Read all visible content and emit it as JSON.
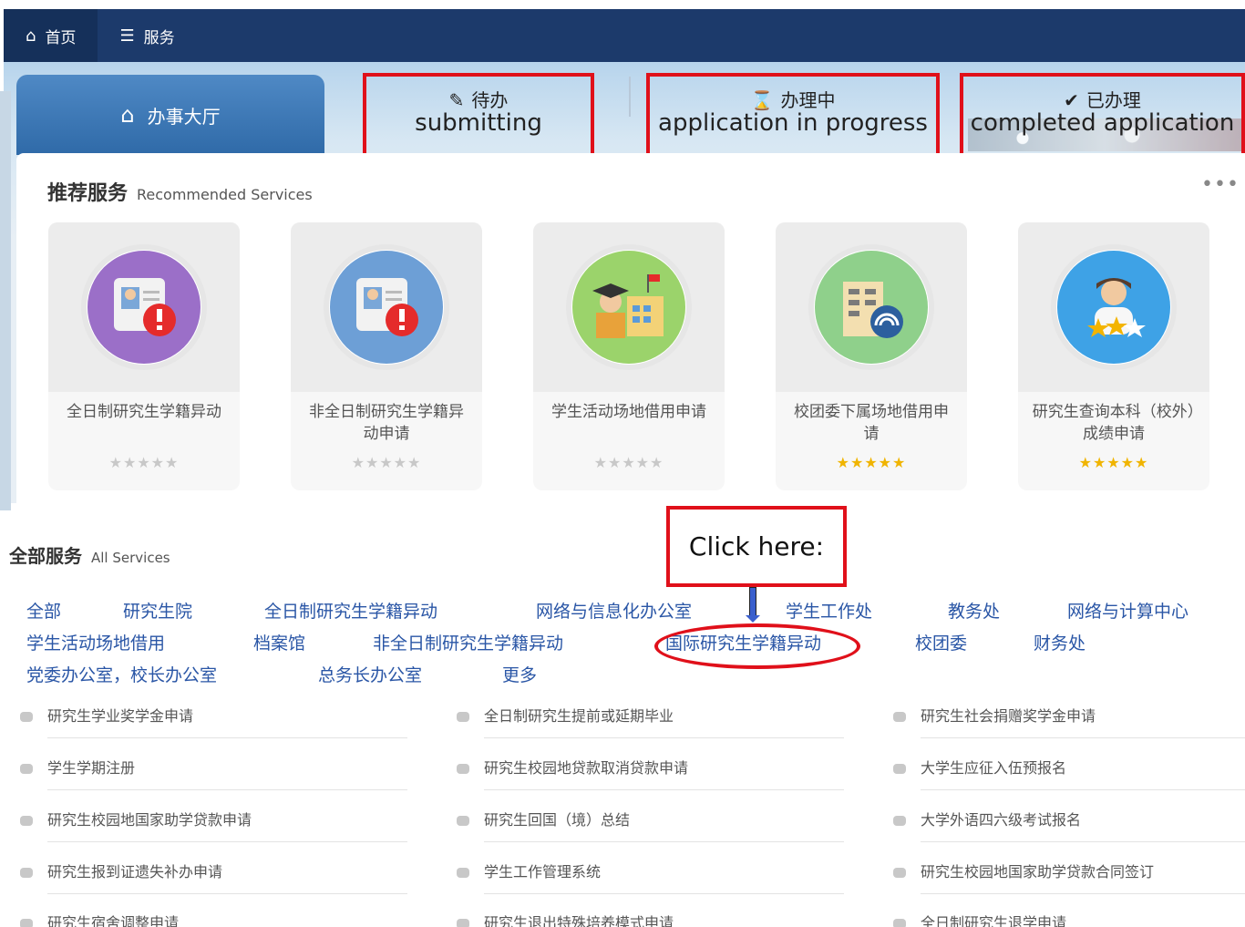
{
  "nav": {
    "home": "首页",
    "services": "服务"
  },
  "tabs": {
    "hall": "办事大厅",
    "pending_zh": "待办",
    "pending_en": "submitting",
    "inprogress_zh": "办理中",
    "inprogress_en": "application in progress",
    "done_zh": "已办理",
    "done_en": "completed application"
  },
  "recommended": {
    "title": "推荐服务",
    "subtitle": "Recommended Services",
    "more": "•••",
    "cards": [
      {
        "label": "全日制研究生学籍异动",
        "stars": "★★★★★",
        "rated": false
      },
      {
        "label": "非全日制研究生学籍异动申请",
        "stars": "★★★★★",
        "rated": false
      },
      {
        "label": "学生活动场地借用申请",
        "stars": "★★★★★",
        "rated": false
      },
      {
        "label": "校团委下属场地借用申请",
        "stars": "★★★★★",
        "rated": true
      },
      {
        "label": "研究生查询本科（校外）成绩申请",
        "stars": "★★★★★",
        "rated": true
      }
    ]
  },
  "all_services": {
    "title": "全部服务",
    "subtitle": "All Services",
    "callout": "Click here:",
    "categories": [
      "全部",
      "研究生院",
      "全日制研究生学籍异动",
      "网络与信息化办公室",
      "学生工作处",
      "教务处",
      "网络与计算中心",
      "学生活动场地借用",
      "档案馆",
      "非全日制研究生学籍异动",
      "国际研究生学籍异动",
      "校团委",
      "财务处",
      "党委办公室，校长办公室",
      "总务长办公室",
      "更多"
    ],
    "services": [
      "研究生学业奖学金申请",
      "全日制研究生提前或延期毕业",
      "研究生社会捐赠奖学金申请",
      "学生学期注册",
      "研究生校园地贷款取消贷款申请",
      "大学生应征入伍预报名",
      "研究生校园地国家助学贷款申请",
      "研究生回国（境）总结",
      "大学外语四六级考试报名",
      "研究生报到证遗失补办申请",
      "学生工作管理系统",
      "研究生校园地国家助学贷款合同签订",
      "研究生宿舍调整申请",
      "研究生退出特殊培养模式申请",
      "全日制研究生退学申请"
    ]
  }
}
